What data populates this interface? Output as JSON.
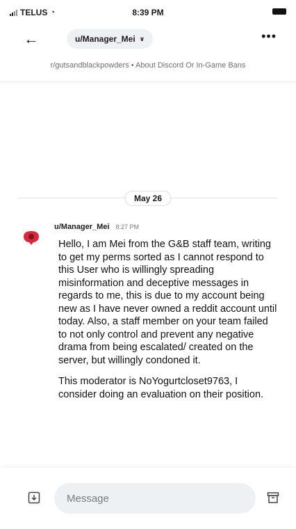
{
  "status_bar": {
    "carrier": "TELUS",
    "time": "8:39 PM"
  },
  "nav": {
    "username": "u/Manager_Mei",
    "back_icon": "back-arrow-icon",
    "chevron_icon": "chevron-down-icon",
    "more_icon": "more-horizontal-icon"
  },
  "subtitle": "r/gutsandblackpowders • About Discord Or In-Game Bans",
  "conversation": {
    "date_label": "May 26",
    "message": {
      "author": "u/Manager_Mei",
      "time": "8:27 PM",
      "paragraphs": [
        "Hello, I am Mei from the G&B staff team, writing to get my perms sorted as I cannot respond to this User who is willingly spreading misinformation and deceptive messages in regards to me, this is due to my account being new as I have never owned a reddit account until today. Also, a staff member on your team failed to not only control and prevent any negative drama from being escalated/ created on the server, but willingly condoned it.",
        "This moderator is NoYogurtcloset9763, I consider doing an evaluation on their position."
      ]
    }
  },
  "composer": {
    "placeholder": "Message",
    "attach_icon": "attachment-icon",
    "archive_icon": "archive-icon"
  },
  "colors": {
    "avatar_red": "#d8283c",
    "pill_bg": "#eef1f4",
    "muted_text": "#6e6e6e"
  }
}
